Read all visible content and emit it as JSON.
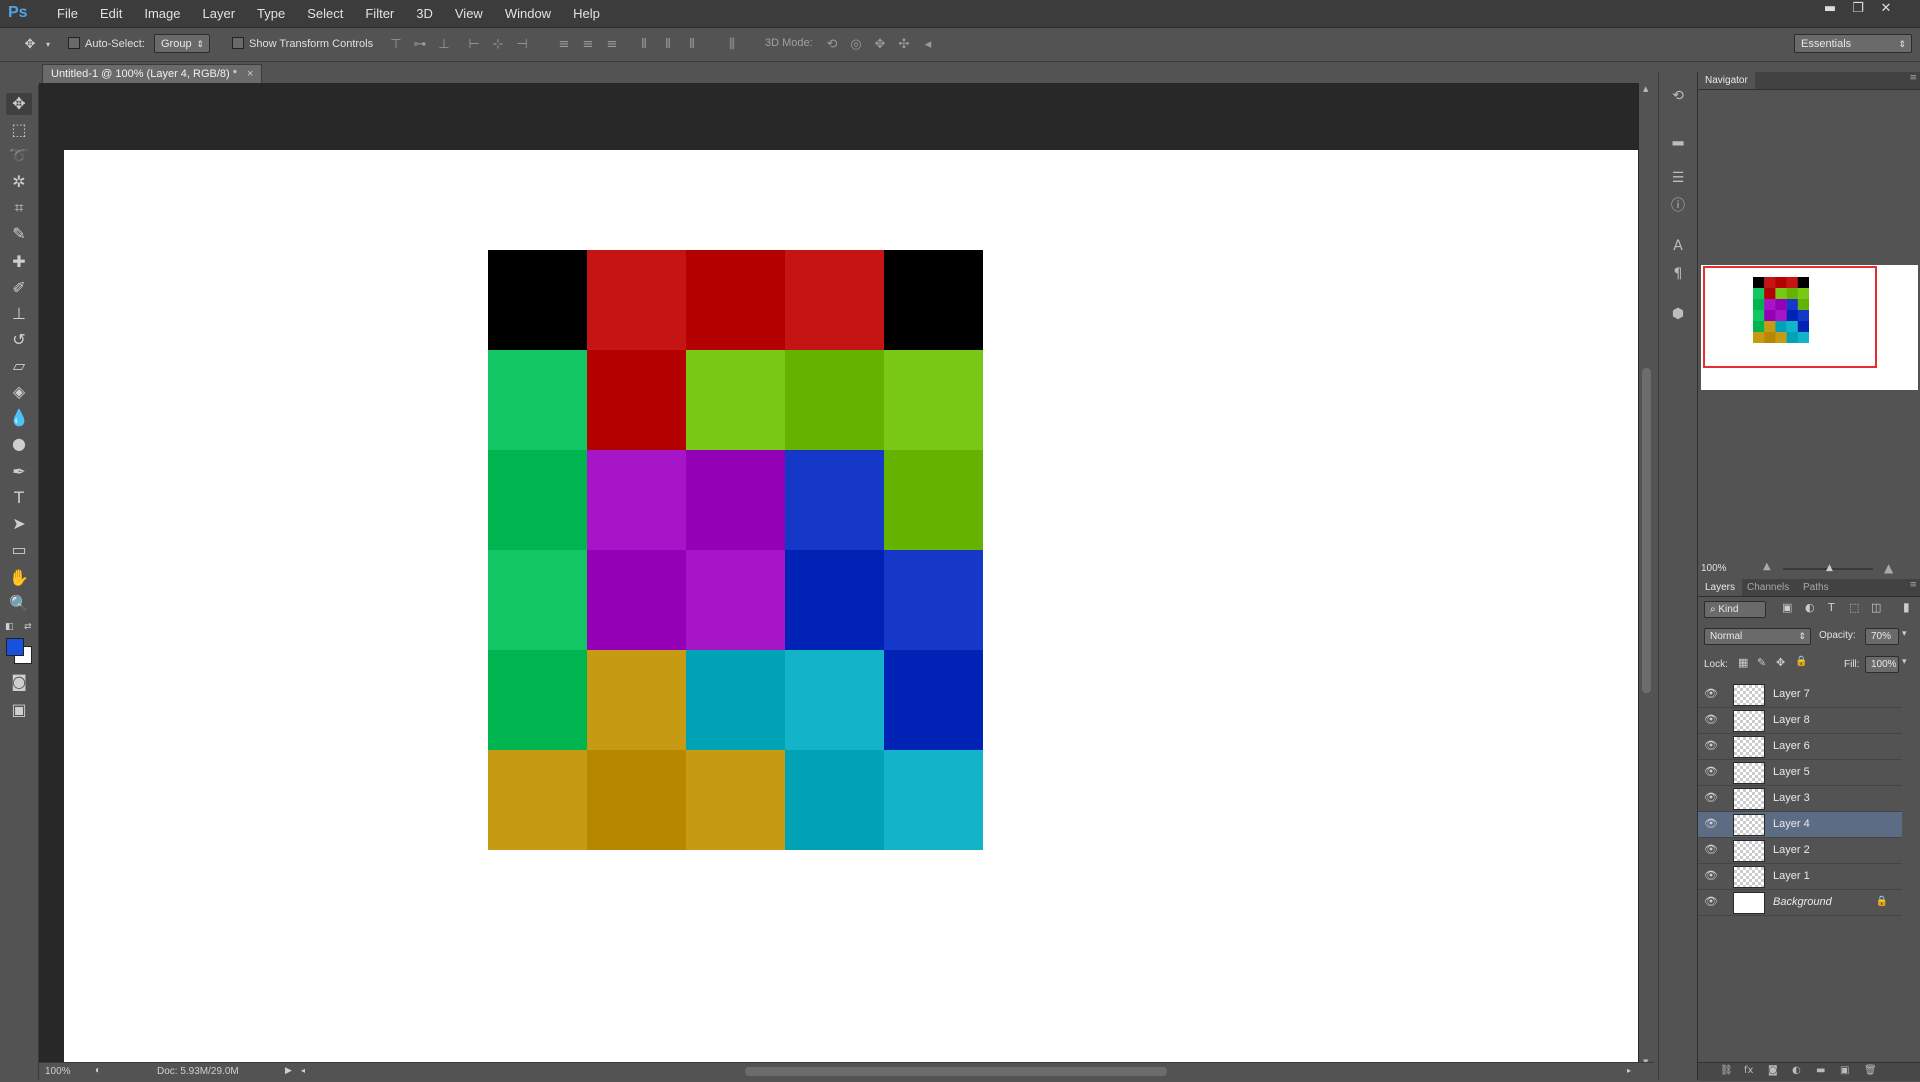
{
  "app": {
    "logo": "Ps"
  },
  "menu": [
    "File",
    "Edit",
    "Image",
    "Layer",
    "Type",
    "Select",
    "Filter",
    "3D",
    "View",
    "Window",
    "Help"
  ],
  "window_controls": {
    "minimize": "▬",
    "restore": "❐",
    "close": "✕"
  },
  "options": {
    "auto_select_label": "Auto-Select:",
    "auto_select_value": "Group",
    "show_transform_label": "Show Transform Controls",
    "mode_3d_label": "3D Mode:",
    "workspace": "Essentials"
  },
  "document": {
    "tab_title": "Untitled-1 @ 100% (Layer 4, RGB/8) *",
    "tab_close": "×"
  },
  "status": {
    "zoom": "100%",
    "doc_info": "Doc: 5.93M/29.0M"
  },
  "artwork": {
    "tiles": [
      [
        "#000000",
        "#c41414",
        "#b50000",
        "#c41414",
        "#000000"
      ],
      [
        "#12c663",
        "#b50000",
        "#7ac816",
        "#66b200",
        "#7ac816"
      ],
      [
        "#00b550",
        "#a615c8",
        "#9400b5",
        "#1538c8",
        "#66b200"
      ],
      [
        "#12c663",
        "#9400b5",
        "#a615c8",
        "#0022b5",
        "#1538c8"
      ],
      [
        "#00b550",
        "#c69a12",
        "#00a3b5",
        "#13b3c8",
        "#0022b5"
      ],
      [
        "#c69a12",
        "#b58800",
        "#c69a12",
        "#00a3b5",
        "#13b3c8"
      ]
    ]
  },
  "colors": {
    "foreground": "#1850e0",
    "background": "#ffffff",
    "accent_selection": "#5c6c85"
  },
  "navigator": {
    "tab": "Navigator",
    "zoom": "100%"
  },
  "layers_panel": {
    "tabs": [
      "Layers",
      "Channels",
      "Paths"
    ],
    "filter_kind": "Kind",
    "blend_mode": "Normal",
    "opacity_label": "Opacity:",
    "opacity_value": "70%",
    "lock_label": "Lock:",
    "fill_label": "Fill:",
    "fill_value": "100%",
    "layers": [
      {
        "name": "Layer 7",
        "selected": false
      },
      {
        "name": "Layer 8",
        "selected": false
      },
      {
        "name": "Layer 6",
        "selected": false
      },
      {
        "name": "Layer 5",
        "selected": false
      },
      {
        "name": "Layer 3",
        "selected": false
      },
      {
        "name": "Layer 4",
        "selected": true
      },
      {
        "name": "Layer 2",
        "selected": false
      },
      {
        "name": "Layer 1",
        "selected": false
      },
      {
        "name": "Background",
        "selected": false,
        "locked": true
      }
    ]
  },
  "icons": {
    "eye": "👁",
    "lock": "🔒",
    "tools": [
      "move-tool-icon",
      "marquee-tool-icon",
      "lasso-tool-icon",
      "magic-wand-icon",
      "crop-tool-icon",
      "eyedropper-icon",
      "healing-brush-icon",
      "brush-tool-icon",
      "clone-stamp-icon",
      "history-brush-icon",
      "eraser-icon",
      "paint-bucket-icon",
      "blur-tool-icon",
      "dodge-tool-icon",
      "pen-tool-icon",
      "type-tool-icon",
      "path-selection-icon",
      "rectangle-tool-icon",
      "hand-tool-icon",
      "zoom-tool-icon"
    ]
  }
}
